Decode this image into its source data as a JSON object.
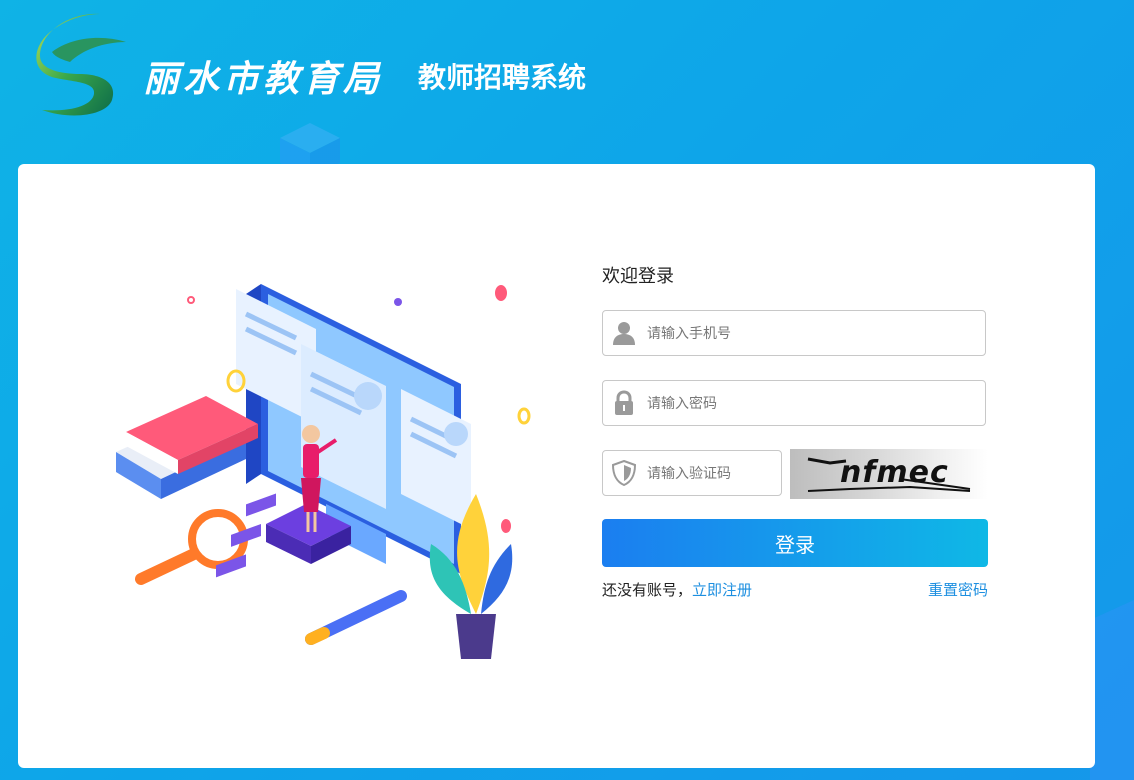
{
  "header": {
    "org_name": "丽水市教育局",
    "system_name": "教师招聘系统"
  },
  "login": {
    "welcome": "欢迎登录",
    "phone_placeholder": "请输入手机号",
    "password_placeholder": "请输入密码",
    "captcha_placeholder": "请输入验证码",
    "captcha_text": "nfmec",
    "login_button": "登录",
    "no_account_text": "还没有账号，",
    "register_link": "立即注册",
    "reset_link": "重置密码"
  },
  "colors": {
    "background": "#0ea5e9",
    "button_start": "#1b7ef0",
    "button_end": "#0fb8e6",
    "link": "#1d8fe0"
  },
  "icons": [
    "user-icon",
    "lock-icon",
    "shield-icon"
  ]
}
